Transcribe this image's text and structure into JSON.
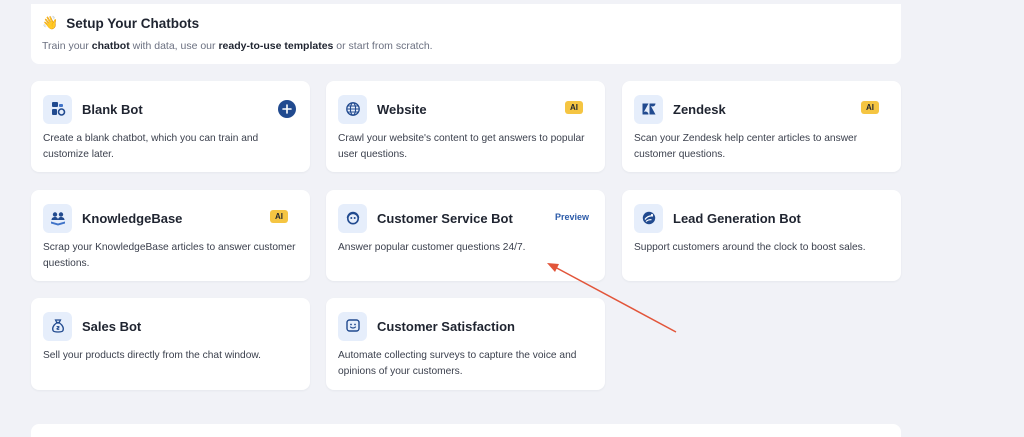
{
  "header": {
    "wave_emoji": "👋",
    "title": "Setup Your Chatbots",
    "subtitle_pre": "Train your ",
    "subtitle_b1": "chatbot",
    "subtitle_mid": " with data, use our ",
    "subtitle_b2": "ready-to-use templates",
    "subtitle_post": " or start from scratch."
  },
  "cards": [
    {
      "title": "Blank Bot",
      "desc": "Create a blank chatbot, which you can train and customize later.",
      "icon": "bot-blocks-icon",
      "badge": "plus"
    },
    {
      "title": "Website",
      "desc": "Crawl your website's content to get answers to popular user questions.",
      "icon": "globe-icon",
      "badge": "AI"
    },
    {
      "title": "Zendesk",
      "desc": "Scan your Zendesk help center articles to answer customer questions.",
      "icon": "zendesk-logo-icon",
      "badge": "AI"
    },
    {
      "title": "KnowledgeBase",
      "desc": "Scrap your KnowledgeBase articles to answer customer questions.",
      "icon": "people-book-icon",
      "badge": "AI"
    },
    {
      "title": "Customer Service Bot",
      "desc": "Answer popular customer questions 24/7.",
      "icon": "headset-icon",
      "badge": "Preview"
    },
    {
      "title": "Lead Generation Bot",
      "desc": "Support customers around the clock to boost sales.",
      "icon": "satellite-dish-icon",
      "badge": ""
    },
    {
      "title": "Sales Bot",
      "desc": "Sell your products directly from the chat window.",
      "icon": "money-bag-icon",
      "badge": ""
    },
    {
      "title": "Customer Satisfaction",
      "desc": "Automate collecting surveys to capture the voice and opinions of your customers.",
      "icon": "smiley-chat-icon",
      "badge": ""
    }
  ],
  "colors": {
    "accent": "#214a8f",
    "ai_badge": "#f5c542",
    "icon_bg": "#e6eefb",
    "annotation_arrow": "#e2553a"
  }
}
